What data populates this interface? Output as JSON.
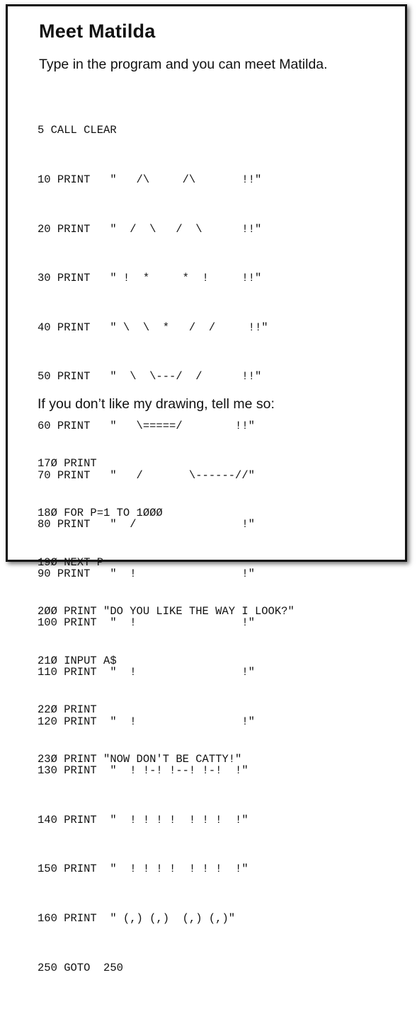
{
  "title": "Meet Matilda",
  "intro": "Type in the program and you can meet Matilda.",
  "program_lines": [
    "5 CALL CLEAR",
    "10 PRINT   \"   /\\     /\\       !!\"",
    "20 PRINT   \"  /  \\   /  \\      !!\"",
    "30 PRINT   \" !  *     *  !     !!\"",
    "40 PRINT   \" \\  \\  *   /  /     !!\"",
    "50 PRINT   \"  \\  \\---/  /      !!\"",
    "60 PRINT   \"   \\=====/        !!\"",
    "70 PRINT   \"   /       \\------//\"",
    "80 PRINT   \"  /                !\"",
    "90 PRINT   \"  !                !\"",
    "100 PRINT  \"  !                !\"",
    "110 PRINT  \"  !                !\"",
    "120 PRINT  \"  !                !\"",
    "130 PRINT  \"  ! !-! !--! !-!  !\"",
    "140 PRINT  \"  ! ! ! !  ! ! !  !\"",
    "150 PRINT  \"  ! ! ! !  ! ! !  !\"",
    "160 PRINT  \" (,) (,)  (,) (,)\"",
    "250 GOTO  250"
  ],
  "middle_text": "If you don’t like my drawing, tell me so:",
  "addon_lines": [
    "17Ø PRINT",
    "18Ø FOR P=1 TO 1ØØØ",
    "19Ø NEXT P",
    "2ØØ PRINT \"DO YOU LIKE THE WAY I LOOK?\"",
    "21Ø INPUT A$",
    "22Ø PRINT",
    "23Ø PRINT \"NOW DON'T BE CATTY!\""
  ]
}
